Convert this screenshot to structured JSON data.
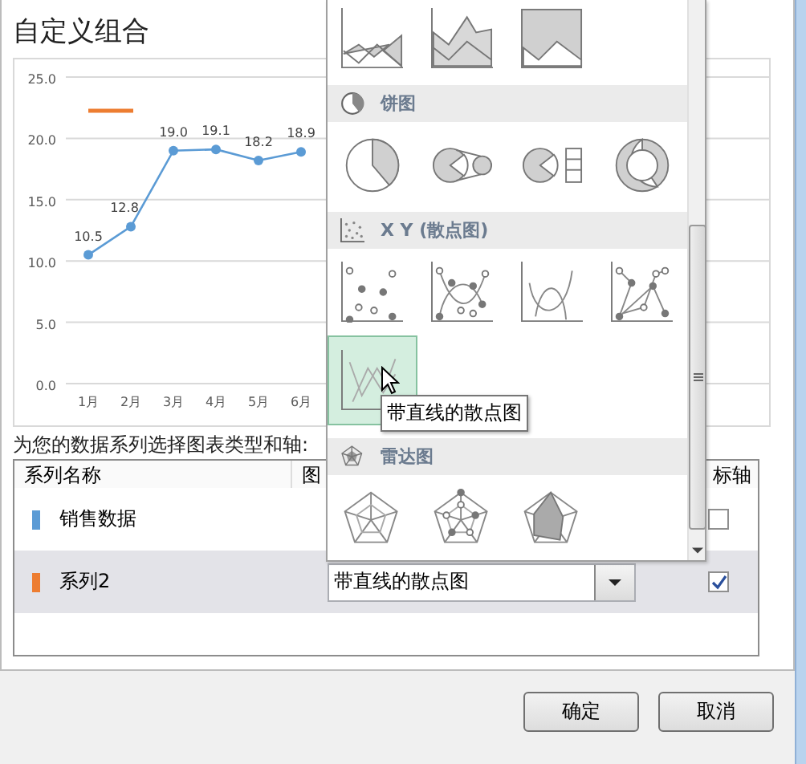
{
  "dialog": {
    "chart_title": "自定义组合",
    "chart": {
      "chart_data": {
        "type": "line",
        "categories": [
          "1月",
          "2月",
          "3月",
          "4月",
          "5月",
          "6月"
        ],
        "series": [
          {
            "color": "#5b9bd5",
            "marker": "circle",
            "values": [
              10.5,
              12.8,
              19.0,
              19.1,
              18.2,
              18.9
            ]
          }
        ],
        "grid": true,
        "value_labels": [
          "10.5",
          "12.8",
          "19.0",
          "19.1",
          "18.2",
          "18.9"
        ],
        "ylim": [
          0,
          25
        ],
        "yticks": [
          {
            "value": 0,
            "label": "0.0"
          },
          {
            "value": 5,
            "label": "5.0"
          },
          {
            "value": 10,
            "label": "10.0"
          },
          {
            "value": 15,
            "label": "15.0"
          },
          {
            "value": 20,
            "label": "20.0"
          },
          {
            "value": 25,
            "label": "25.0"
          }
        ]
      }
    },
    "series_prompt": "为您的数据系列选择图表类型和轴:",
    "table": {
      "columns": [
        "系列名称",
        "图",
        "标轴"
      ],
      "rows": [
        {
          "name": "销售数据",
          "color": "#5b9bd5",
          "selected": false,
          "secondary_axis": false
        },
        {
          "name": "系列2",
          "color": "#ed7d31",
          "selected": true,
          "chart_type": "带直线的散点图",
          "secondary_axis": true
        }
      ]
    },
    "buttons": [
      "确定",
      "取消"
    ]
  },
  "gallery": {
    "sections": [
      {
        "items": [
          {
            "kind": "area",
            "selected": false
          },
          {
            "kind": "stacked-area",
            "selected": false
          },
          {
            "kind": "full-area",
            "selected": false
          }
        ]
      },
      {
        "kind": "pie",
        "title": "饼图",
        "items": [
          {
            "kind": "pie",
            "selected": false
          },
          {
            "kind": "pie-of-pie",
            "selected": false
          },
          {
            "kind": "bar-of-pie",
            "selected": false
          },
          {
            "kind": "doughnut",
            "selected": false
          }
        ]
      },
      {
        "kind": "scatter",
        "title": "X Y (散点图)",
        "items": [
          {
            "kind": "scatter",
            "selected": false
          },
          {
            "kind": "smooth-markers",
            "selected": false
          },
          {
            "kind": "smooth",
            "selected": false
          },
          {
            "kind": "lines-markers",
            "selected": false
          },
          {
            "kind": "lines",
            "selected": true
          }
        ]
      },
      {
        "kind": "radar",
        "title": "雷达图",
        "items": [
          {
            "kind": "radar",
            "selected": false
          },
          {
            "kind": "radar-markers",
            "selected": false
          },
          {
            "kind": "filled-radar",
            "selected": false
          }
        ]
      }
    ]
  },
  "tooltip": "带直线的散点图"
}
